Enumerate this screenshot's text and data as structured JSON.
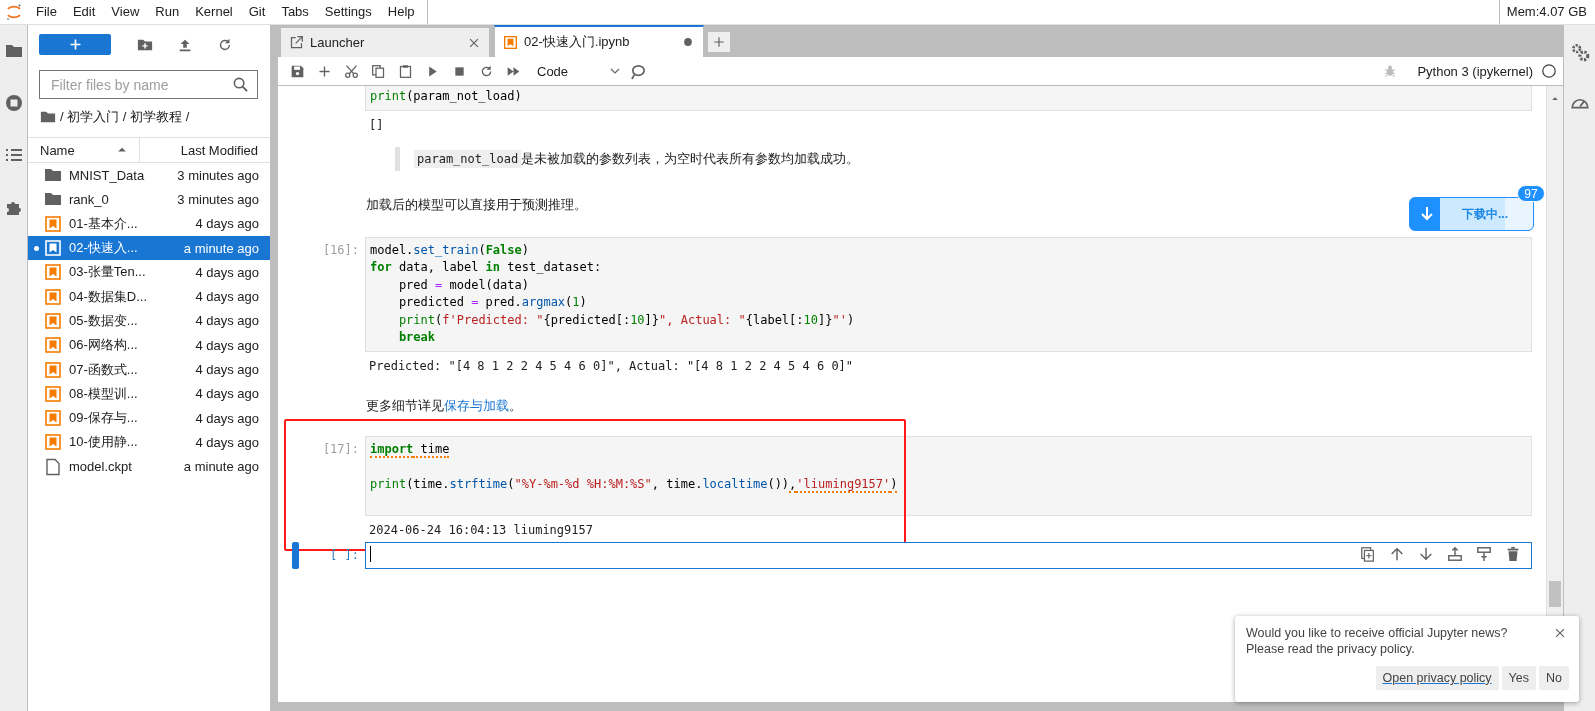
{
  "menu_items": [
    "File",
    "Edit",
    "View",
    "Run",
    "Kernel",
    "Git",
    "Tabs",
    "Settings",
    "Help"
  ],
  "memory": "Mem:4.07 GB",
  "file_browser": {
    "filter": {
      "placeholder": "Filter files by name"
    },
    "breadcrumb": "/ 初学入门 / 初学教程 /",
    "columns": [
      {
        "label": "Name",
        "sorted": true
      },
      {
        "label": "Last Modified",
        "sorted": false
      }
    ],
    "files": [
      {
        "name": "MNIST_Data",
        "modified": "3 minutes ago",
        "kind": "folder",
        "selected": false,
        "running": false
      },
      {
        "name": "rank_0",
        "modified": "3 minutes ago",
        "kind": "folder",
        "selected": false,
        "running": false
      },
      {
        "name": "01-基本介...",
        "modified": "4 days ago",
        "kind": "notebook",
        "selected": false,
        "running": false
      },
      {
        "name": "02-快速入...",
        "modified": "a minute ago",
        "kind": "notebook",
        "selected": true,
        "running": true
      },
      {
        "name": "03-张量Ten...",
        "modified": "4 days ago",
        "kind": "notebook",
        "selected": false,
        "running": false
      },
      {
        "name": "04-数据集D...",
        "modified": "4 days ago",
        "kind": "notebook",
        "selected": false,
        "running": false
      },
      {
        "name": "05-数据变...",
        "modified": "4 days ago",
        "kind": "notebook",
        "selected": false,
        "running": false
      },
      {
        "name": "06-网络构...",
        "modified": "4 days ago",
        "kind": "notebook",
        "selected": false,
        "running": false
      },
      {
        "name": "07-函数式...",
        "modified": "4 days ago",
        "kind": "notebook",
        "selected": false,
        "running": false
      },
      {
        "name": "08-模型训...",
        "modified": "4 days ago",
        "kind": "notebook",
        "selected": false,
        "running": false
      },
      {
        "name": "09-保存与...",
        "modified": "4 days ago",
        "kind": "notebook",
        "selected": false,
        "running": false
      },
      {
        "name": "10-使用静...",
        "modified": "4 days ago",
        "kind": "notebook",
        "selected": false,
        "running": false
      },
      {
        "name": "model.ckpt",
        "modified": "a minute ago",
        "kind": "file",
        "selected": false,
        "running": false
      }
    ]
  },
  "tabs": [
    {
      "label": "Launcher",
      "kind": "launcher",
      "selected": false,
      "unsaved": false
    },
    {
      "label": "02-快速入门.ipynb",
      "kind": "notebook",
      "selected": true,
      "unsaved": true
    }
  ],
  "toolbar": {
    "cell_type": "Code",
    "kernel": "Python 3 (ipykernel)"
  },
  "cells": [
    {
      "kind": "code",
      "active": false,
      "annotated": false,
      "lines": [
        {
          "kind": "code",
          "tokens": [
            {
              "kind": "builtin",
              "text": "print"
            },
            {
              "kind": "plain",
              "text": "(param_not_load)"
            }
          ]
        }
      ],
      "output": "[]"
    },
    {
      "kind": "quote",
      "code": "param_not_load",
      "text": "是未被加载的参数列表，为空时代表所有参数均加载成功。"
    },
    {
      "kind": "paragraph",
      "text": "加载后的模型可以直接用于预测推理。"
    },
    {
      "kind": "code",
      "prompt": "[16]:",
      "active": false,
      "annotated": false,
      "lines": [
        {
          "kind": "code",
          "tokens": [
            {
              "kind": "plain",
              "text": "model."
            },
            {
              "kind": "fn",
              "text": "set_train"
            },
            {
              "kind": "plain",
              "text": "("
            },
            {
              "kind": "kw",
              "text": "False"
            },
            {
              "kind": "plain",
              "text": ")"
            }
          ]
        },
        {
          "kind": "code",
          "tokens": [
            {
              "kind": "kw",
              "text": "for"
            },
            {
              "kind": "plain",
              "text": " data, label "
            },
            {
              "kind": "kw",
              "text": "in"
            },
            {
              "kind": "plain",
              "text": " test_dataset:"
            }
          ]
        },
        {
          "kind": "code",
          "tokens": [
            {
              "kind": "plain",
              "text": "    pred "
            },
            {
              "kind": "op",
              "text": "="
            },
            {
              "kind": "plain",
              "text": " model(data)"
            }
          ]
        },
        {
          "kind": "code",
          "tokens": [
            {
              "kind": "plain",
              "text": "    predicted "
            },
            {
              "kind": "op",
              "text": "="
            },
            {
              "kind": "plain",
              "text": " pred."
            },
            {
              "kind": "fn",
              "text": "argmax"
            },
            {
              "kind": "plain",
              "text": "("
            },
            {
              "kind": "num",
              "text": "1"
            },
            {
              "kind": "plain",
              "text": ")"
            }
          ]
        },
        {
          "kind": "code",
          "tokens": [
            {
              "kind": "builtin",
              "text": "    print"
            },
            {
              "kind": "plain",
              "text": "("
            },
            {
              "kind": "str",
              "text": "f'Predicted: \""
            },
            {
              "kind": "plain",
              "text": "{predicted[:"
            },
            {
              "kind": "num",
              "text": "10"
            },
            {
              "kind": "plain",
              "text": "]}"
            },
            {
              "kind": "str",
              "text": "\", Actual: \""
            },
            {
              "kind": "plain",
              "text": "{label[:"
            },
            {
              "kind": "num",
              "text": "10"
            },
            {
              "kind": "plain",
              "text": "]}"
            },
            {
              "kind": "str",
              "text": "\"'"
            },
            {
              "kind": "plain",
              "text": ")"
            }
          ]
        },
        {
          "kind": "code",
          "tokens": [
            {
              "kind": "kw",
              "text": "    break"
            }
          ]
        }
      ],
      "output": "Predicted: \"[4 8 1 2 2 4 5 4 6 0]\", Actual: \"[4 8 1 2 2 4 5 4 6 0]\""
    },
    {
      "kind": "paragraph",
      "text": "更多细节详见",
      "link": "保存与加载",
      "after": "。"
    },
    {
      "kind": "code",
      "prompt": "[17]:",
      "active": false,
      "annotated": true,
      "lines": [
        {
          "kind": "code",
          "tokens": [
            {
              "kind": "kw",
              "text": "import",
              "squiggle": true
            },
            {
              "kind": "plain",
              "text": " time",
              "squiggle": true
            }
          ]
        },
        {
          "kind": "blank"
        },
        {
          "kind": "code",
          "tokens": [
            {
              "kind": "builtin",
              "text": "print"
            },
            {
              "kind": "plain",
              "text": "(time."
            },
            {
              "kind": "fn",
              "text": "strftime"
            },
            {
              "kind": "plain",
              "text": "("
            },
            {
              "kind": "str",
              "text": "\"%Y-%m-%d %H:%M:%S\""
            },
            {
              "kind": "plain",
              "text": ", time."
            },
            {
              "kind": "fn",
              "text": "localtime"
            },
            {
              "kind": "plain",
              "text": "())"
            },
            {
              "kind": "plain",
              "text": ",",
              "squiggle": true
            },
            {
              "kind": "str",
              "text": "'liuming9157'",
              "squiggle": true
            },
            {
              "kind": "plain",
              "text": ")",
              "squiggle": true
            }
          ]
        },
        {
          "kind": "blank"
        }
      ],
      "output": "2024-06-24 16:04:13 liuming9157"
    },
    {
      "kind": "code",
      "prompt": "[ ]:",
      "active": true,
      "annotated": false
    }
  ],
  "download": {
    "label": "下载中...",
    "count": "97"
  },
  "notice": {
    "lines": [
      "Would you like to receive official Jupyter news?",
      "Please read the privacy policy."
    ],
    "buttons": [
      {
        "label": "Open privacy policy",
        "kind": "link"
      },
      {
        "label": "Yes",
        "kind": "plain"
      },
      {
        "label": "No",
        "kind": "plain"
      }
    ]
  }
}
